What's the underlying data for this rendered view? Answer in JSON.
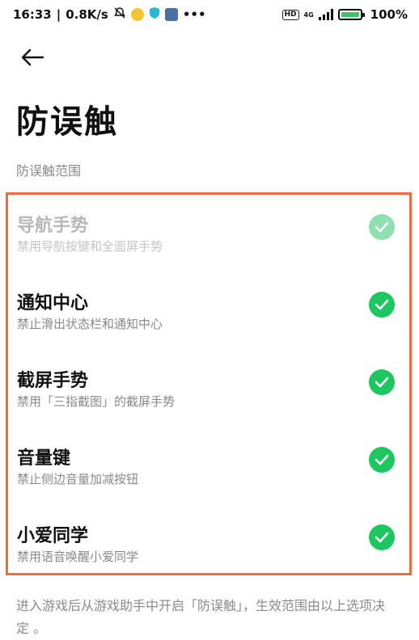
{
  "status_bar": {
    "time": "16:33",
    "speed": "0.8K/s",
    "battery_text": "100%",
    "hd_label": "HD",
    "network_label": "4G",
    "icons": [
      "bell-off-icon",
      "app-icon",
      "shield-icon",
      "gear-icon",
      "more-icon"
    ]
  },
  "page": {
    "title": "防误触",
    "section_label": "防误触范围"
  },
  "options": [
    {
      "title": "导航手势",
      "description": "禁用导航按键和全面屏手势",
      "checked": true,
      "disabled": true
    },
    {
      "title": "通知中心",
      "description": "禁止滑出状态栏和通知中心",
      "checked": true,
      "disabled": false
    },
    {
      "title": "截屏手势",
      "description": "禁用「三指截图」的截屏手势",
      "checked": true,
      "disabled": false
    },
    {
      "title": "音量键",
      "description": "禁止侧边音量加减按钮",
      "checked": true,
      "disabled": false
    },
    {
      "title": "小爱同学",
      "description": "禁用语音唤醒小爱同学",
      "checked": true,
      "disabled": false
    }
  ],
  "footer_note": "进入游戏后从游戏助手中开启「防误触」，生效范围由以上选项决定 。",
  "colors": {
    "accent_green": "#1cc760",
    "highlight_border": "#f26a3f",
    "secondary_text": "#8a8a8a"
  }
}
